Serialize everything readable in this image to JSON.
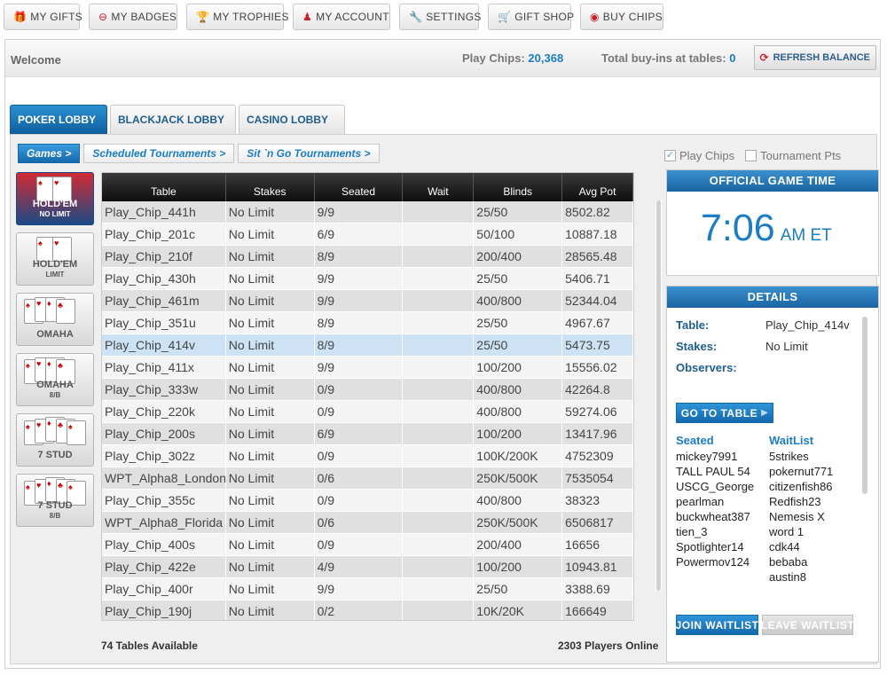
{
  "topnav": [
    {
      "label": "MY GIFTS",
      "icon": "gift-icon"
    },
    {
      "label": "MY BADGES",
      "icon": "badge-icon"
    },
    {
      "label": "MY TROPHIES",
      "icon": "trophy-icon"
    },
    {
      "label": "MY ACCOUNT",
      "icon": "account-icon"
    },
    {
      "label": "SETTINGS",
      "icon": "wrench-icon"
    },
    {
      "label": "GIFT SHOP",
      "icon": "cart-icon"
    },
    {
      "label": "BUY CHIPS",
      "icon": "chips-icon"
    }
  ],
  "header": {
    "welcome": "Welcome",
    "play_chips_label": "Play Chips:",
    "play_chips_value": "20,368",
    "buyins_label": "Total buy-ins at tables:",
    "buyins_value": "0",
    "refresh_label": "REFRESH BALANCE"
  },
  "tabs": [
    {
      "label": "POKER LOBBY",
      "active": true
    },
    {
      "label": "BLACKJACK LOBBY",
      "active": false
    },
    {
      "label": "CASINO LOBBY",
      "active": false
    }
  ],
  "subtabs": [
    {
      "label": "Games >",
      "active": true
    },
    {
      "label": "Scheduled Tournaments >",
      "active": false
    },
    {
      "label": "Sit `n Go Tournaments >",
      "active": false
    }
  ],
  "filters": {
    "play_chips": "Play Chips",
    "play_chips_checked": true,
    "tournament_pts": "Tournament Pts",
    "tournament_pts_checked": false
  },
  "games": [
    {
      "title": "HOLD'EM",
      "sub": "NO LIMIT",
      "active": true
    },
    {
      "title": "HOLD'EM",
      "sub": "LIMIT",
      "active": false
    },
    {
      "title": "OMAHA",
      "sub": "",
      "active": false
    },
    {
      "title": "OMAHA",
      "sub": "8/B",
      "active": false
    },
    {
      "title": "7 STUD",
      "sub": "",
      "active": false
    },
    {
      "title": "7 STUD",
      "sub": "8/B",
      "active": false
    }
  ],
  "table": {
    "columns": [
      "Table",
      "Stakes",
      "Seated",
      "Wait",
      "Blinds",
      "Avg Pot"
    ],
    "selected_index": 6,
    "rows": [
      [
        "Play_Chip_441h",
        "No Limit",
        "9/9",
        "",
        "25/50",
        "8502.82"
      ],
      [
        "Play_Chip_201c",
        "No Limit",
        "6/9",
        "",
        "50/100",
        "10887.18"
      ],
      [
        "Play_Chip_210f",
        "No Limit",
        "8/9",
        "",
        "200/400",
        "28565.48"
      ],
      [
        "Play_Chip_430h",
        "No Limit",
        "9/9",
        "",
        "25/50",
        "5406.71"
      ],
      [
        "Play_Chip_461m",
        "No Limit",
        "9/9",
        "",
        "400/800",
        "52344.04"
      ],
      [
        "Play_Chip_351u",
        "No Limit",
        "8/9",
        "",
        "25/50",
        "4967.67"
      ],
      [
        "Play_Chip_414v",
        "No Limit",
        "8/9",
        "",
        "25/50",
        "5473.75"
      ],
      [
        "Play_Chip_411x",
        "No Limit",
        "9/9",
        "",
        "100/200",
        "15556.02"
      ],
      [
        "Play_Chip_333w",
        "No Limit",
        "0/9",
        "",
        "400/800",
        "42264.8"
      ],
      [
        "Play_Chip_220k",
        "No Limit",
        "0/9",
        "",
        "400/800",
        "59274.06"
      ],
      [
        "Play_Chip_200s",
        "No Limit",
        "6/9",
        "",
        "100/200",
        "13417.96"
      ],
      [
        "Play_Chip_302z",
        "No Limit",
        "0/9",
        "",
        "100K/200K",
        "4752309"
      ],
      [
        "WPT_Alpha8_London",
        "No Limit",
        "0/6",
        "",
        "250K/500K",
        "7535054"
      ],
      [
        "Play_Chip_355c",
        "No Limit",
        "0/9",
        "",
        "400/800",
        "38323"
      ],
      [
        "WPT_Alpha8_Florida",
        "No Limit",
        "0/6",
        "",
        "250K/500K",
        "6506817"
      ],
      [
        "Play_Chip_400s",
        "No Limit",
        "0/9",
        "",
        "200/400",
        "16656"
      ],
      [
        "Play_Chip_422e",
        "No Limit",
        "4/9",
        "",
        "100/200",
        "10943.81"
      ],
      [
        "Play_Chip_400r",
        "No Limit",
        "9/9",
        "",
        "25/50",
        "3388.69"
      ],
      [
        "Play_Chip_190j",
        "No Limit",
        "0/2",
        "",
        "10K/20K",
        "166649"
      ]
    ]
  },
  "footer": {
    "tables_available": "74 Tables Available",
    "players_online": "2303 Players Online"
  },
  "game_time": {
    "title": "OFFICIAL GAME TIME",
    "time": "7:06",
    "suffix": "AM ET"
  },
  "details": {
    "title": "DETAILS",
    "table_label": "Table:",
    "table_value": "Play_Chip_414v",
    "stakes_label": "Stakes:",
    "stakes_value": "No Limit",
    "observers_label": "Observers:",
    "go_to_table": "GO TO TABLE",
    "seated_label": "Seated",
    "waitlist_label": "WaitList",
    "seated": [
      "mickey7991",
      "TALL PAUL 54",
      "USCG_George",
      "pearlman",
      "buckwheat387",
      "tien_3",
      "Spotlighter14",
      "Powermov124"
    ],
    "waitlist": [
      "5strikes",
      "pokernut771",
      "citizenfish86",
      "Redfish23",
      "Nemesis X",
      "word 1",
      "cdk44",
      "bebaba",
      "austin8"
    ],
    "join_waitlist": "JOIN WAITLIST",
    "leave_waitlist": "LEAVE WAITLIST"
  }
}
